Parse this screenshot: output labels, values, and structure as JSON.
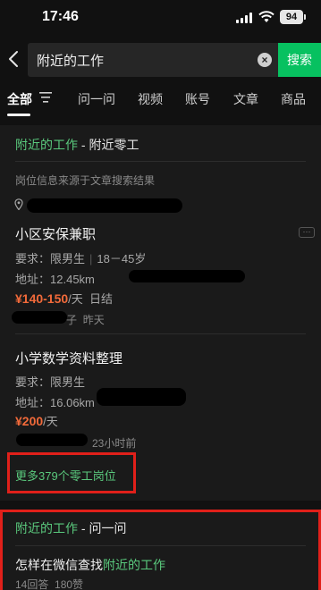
{
  "status_bar": {
    "time": "17:46",
    "battery": "94"
  },
  "search": {
    "query": "附近的工作",
    "button_label": "搜索"
  },
  "tabs": [
    {
      "label": "全部"
    },
    {
      "label": "问一问"
    },
    {
      "label": "视频"
    },
    {
      "label": "账号"
    },
    {
      "label": "文章"
    },
    {
      "label": "商品"
    }
  ],
  "gig_section": {
    "title_highlight": "附近的工作",
    "title_rest": " - 附近零工",
    "note": "岗位信息来源于文章搜索结果",
    "jobs": [
      {
        "title": "小区安保兼职",
        "requirement_label": "要求：",
        "requirement_gender": "限男生",
        "requirement_age": "18－45岁",
        "address_label": "地址：",
        "distance": "12.45km",
        "salary": "¥140-150",
        "salary_unit": "/天",
        "settlement": "日结",
        "source_suffix": "子",
        "posted": "昨天"
      },
      {
        "title": "小学数学资料整理",
        "requirement_label": "要求：",
        "requirement_gender": "限男生",
        "address_label": "地址：",
        "distance": "16.06km",
        "salary": "¥200",
        "salary_unit": "/天",
        "posted": "23小时前"
      }
    ],
    "more_label": "更多379个零工岗位"
  },
  "qa_section": {
    "title_highlight": "附近的工作",
    "title_rest": " - 问一问",
    "question_prefix": "怎样在微信查找",
    "question_highlight": "附近的工作",
    "answers": "14回答",
    "likes": "180赞"
  },
  "colors": {
    "accent_green": "#07c160",
    "link_green": "#5ac97d",
    "salary_orange": "#f26a3a",
    "highlight_red": "#e0201a"
  }
}
